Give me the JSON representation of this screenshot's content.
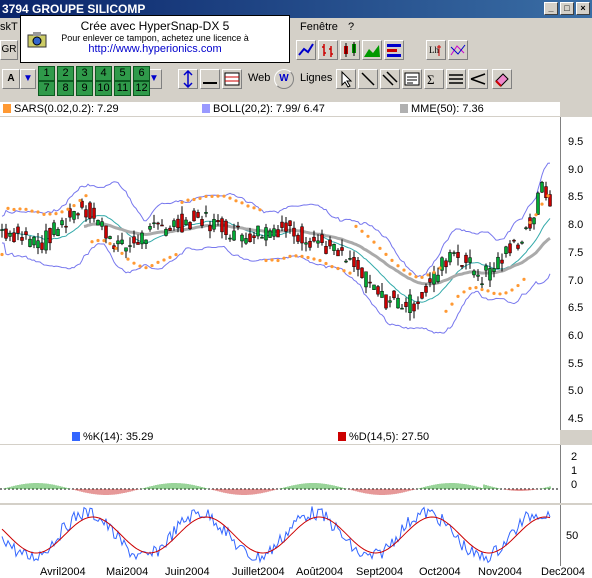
{
  "window": {
    "title": "3794  GROUPE SILICOMP"
  },
  "menu": {
    "items": [
      "skT",
      "Fenêtre",
      "?"
    ]
  },
  "watermark": {
    "line1": "Crée avec HyperSnap-DX 5",
    "line2": "Pour enlever ce tampon, achetez une licence à",
    "line3": "http://www.hyperionics.com"
  },
  "toolbar": {
    "ticker_box": "GR",
    "font_button": "A",
    "period_row1": [
      "1",
      "2",
      "3",
      "4",
      "5",
      "6"
    ],
    "period_row2": [
      "7",
      "8",
      "9",
      "10",
      "11",
      "12"
    ],
    "web_label": "Web",
    "lines_label": "Lignes"
  },
  "indicators": {
    "sar": {
      "label": "SARS(0.02,0.2):",
      "value": "7.29",
      "color": "#ff9933"
    },
    "boll": {
      "label": "BOLL(20,2):",
      "value": "7.99/ 6.47",
      "color": "#9999ff"
    },
    "mme": {
      "label": "MME(50):",
      "value": "7.36",
      "color": "#b0b0b0"
    },
    "stoch_k": {
      "label": "%K(14):",
      "value": "35.29",
      "color": "#3366ff"
    },
    "stoch_d": {
      "label": "%D(14,5):",
      "value": "27.50",
      "color": "#cc0000"
    }
  },
  "price_axis": [
    "9.5",
    "9.0",
    "8.5",
    "8.0",
    "7.5",
    "7.0",
    "6.5",
    "6.0",
    "5.5",
    "5.0",
    "4.5"
  ],
  "osc_axis": [
    "2",
    "1",
    "0"
  ],
  "stoch_axis": [
    "50"
  ],
  "time_axis": [
    "Avril2004",
    "Mai2004",
    "Juin2004",
    "Juillet2004",
    "Août2004",
    "Sept2004",
    "Oct2004",
    "Nov2004",
    "Dec2004"
  ]
}
